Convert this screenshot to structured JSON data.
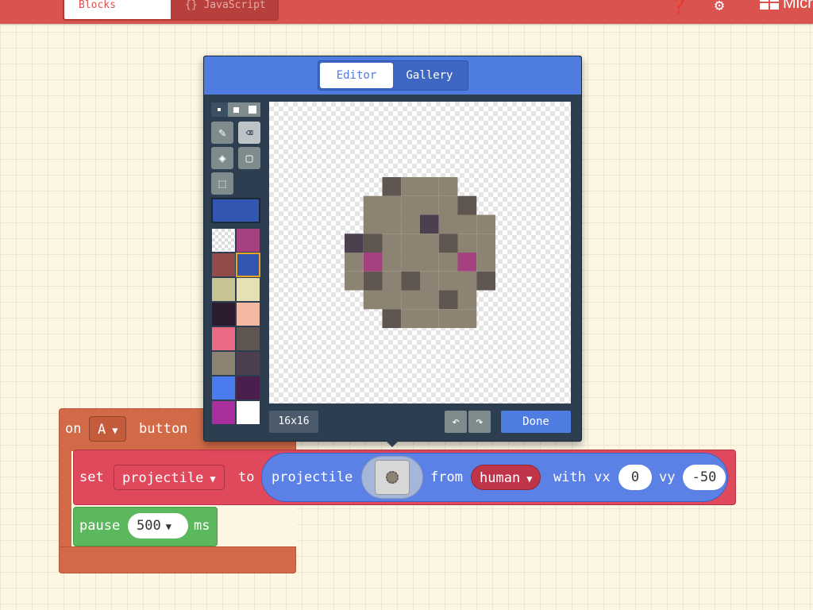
{
  "header": {
    "blocks_label": "Blocks",
    "js_label": "{} JavaScript",
    "brand": "Micr",
    "help_icon": "help-icon",
    "settings_icon": "gear-icon"
  },
  "event_block": {
    "on_label": "on",
    "button_value": "A",
    "button_label": "button"
  },
  "set_block": {
    "set_label": "set",
    "variable": "projectile",
    "to_label": "to",
    "projectile_label": "projectile",
    "from_label": "from",
    "kind_value": "human",
    "vx_label": "with vx",
    "vx_value": "0",
    "vy_label": "vy",
    "vy_value": "-50"
  },
  "pause_block": {
    "label": "pause",
    "value": "500",
    "unit": "ms"
  },
  "editor": {
    "tab_editor": "Editor",
    "tab_gallery": "Gallery",
    "size_label": "16x16",
    "done_label": "Done",
    "current_color": "#3257b3",
    "palette": [
      "transparent",
      "#a4417e",
      "#934c4a",
      "#3257b3",
      "#c9c394",
      "#e5e1b5",
      "#2d1c2f",
      "#f5b8a3",
      "#e86b83",
      "#5f5651",
      "#8d8373",
      "#4c3f4f",
      "#4b7cef",
      "#4a1f4d",
      "#a92f9f",
      "#ffffff"
    ],
    "sprite_pixels": [
      "................",
      "................",
      "................",
      "......DLLL......",
      ".....LLLLLD.....",
      ".....LLLPLLL....",
      "....PDLLLDLL....",
      "....LMLLLLML....",
      "....LDLDLLLD....",
      ".....LLLLDL.....",
      "......DLLLL.....",
      "................"
    ]
  }
}
